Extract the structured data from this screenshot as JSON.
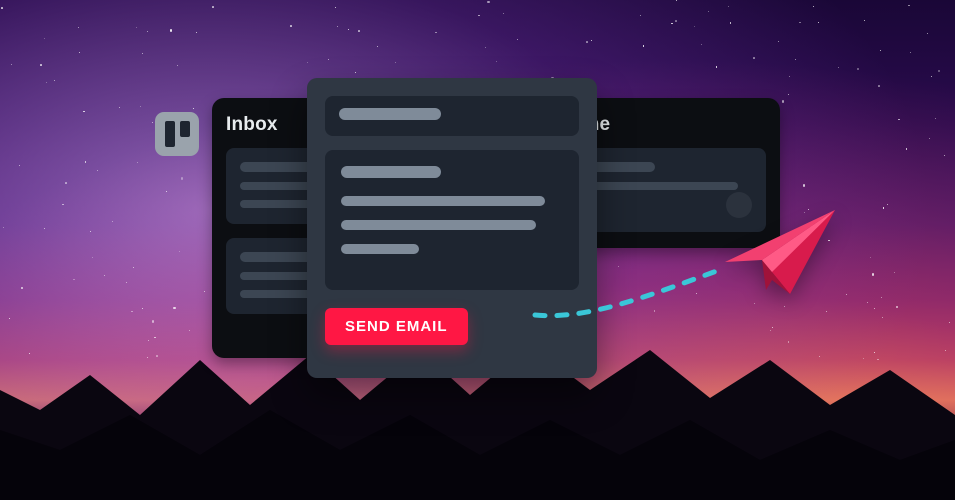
{
  "app_icon": {
    "name": "trello-icon"
  },
  "board": {
    "columns": {
      "inbox": {
        "title": "Inbox"
      },
      "done": {
        "title": "Done"
      }
    }
  },
  "compose": {
    "send_label": "SEND EMAIL"
  },
  "colors": {
    "accent": "#ff1744",
    "panel_dark": "#0c0e12",
    "panel_mid": "#2f3743",
    "card": "#1e2530",
    "placeholder_dark": "#3c4653",
    "placeholder_light": "#7f8b99",
    "trajectory": "#3ac7d8"
  }
}
